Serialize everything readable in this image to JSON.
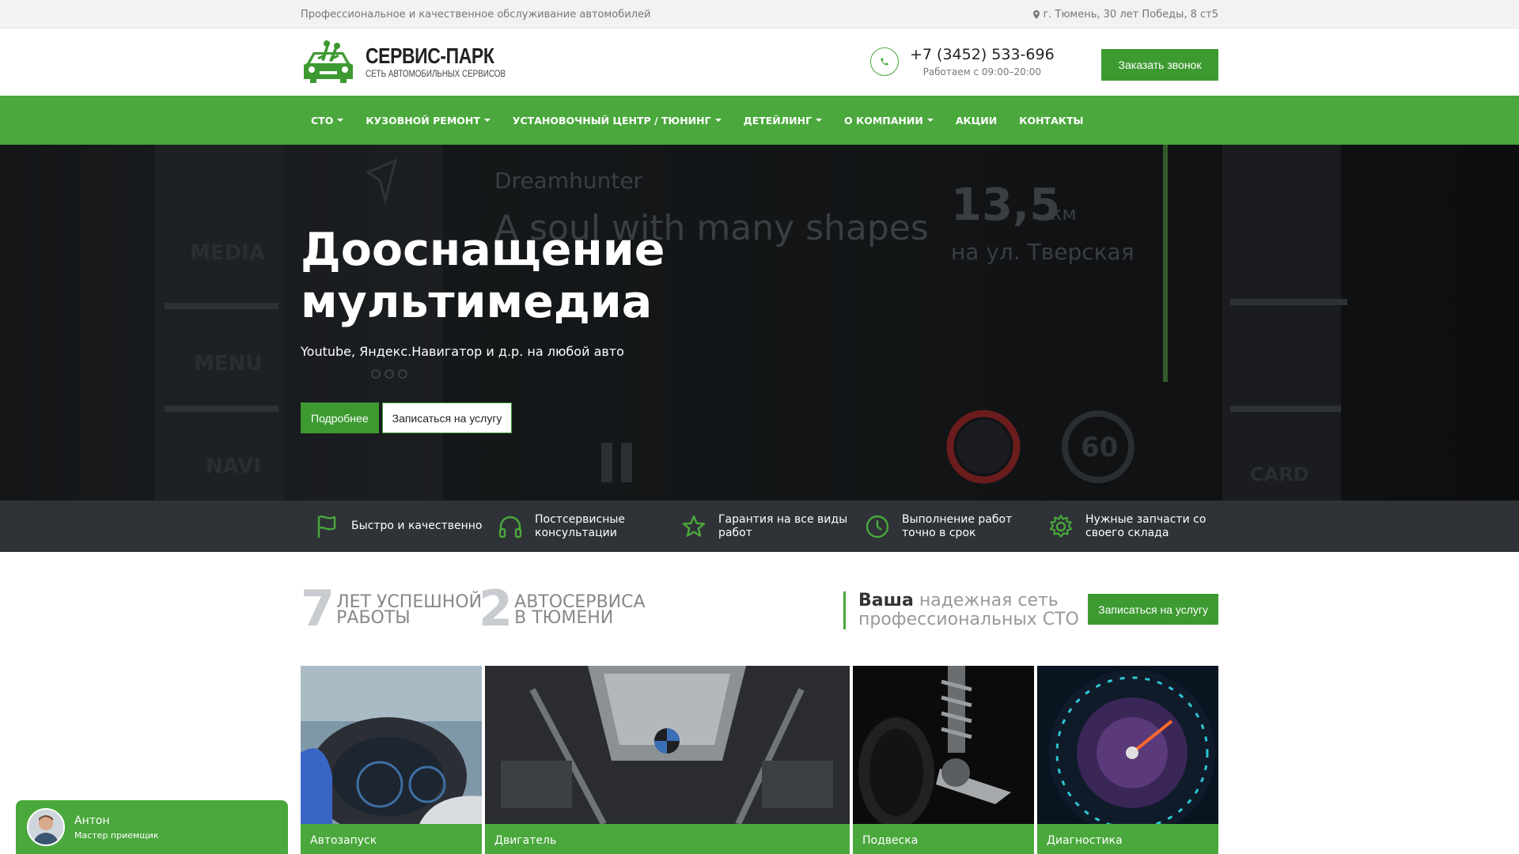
{
  "topbar": {
    "tagline": "Профессиональное и качественное обслуживание автомобилей",
    "address": "г. Тюмень, 30 лет Победы, 8 ст5"
  },
  "header": {
    "logo_title": "СЕРВИС-ПАРК",
    "logo_subtitle": "Сеть автомобильных сервисов",
    "phone": "+7 (3452) 533-696",
    "hours": "Работаем с 09:00–20:00",
    "callback_label": "Заказать звонок"
  },
  "nav": {
    "items": [
      {
        "label": "СТО",
        "dropdown": true
      },
      {
        "label": "КУЗОВНОЙ РЕМОНТ",
        "dropdown": true
      },
      {
        "label": "УСТАНОВОЧНЫЙ ЦЕНТР / ТЮНИНГ",
        "dropdown": true
      },
      {
        "label": "ДЕТЕЙЛИНГ",
        "dropdown": true
      },
      {
        "label": "О КОМПАНИИ",
        "dropdown": true
      },
      {
        "label": "АКЦИИ",
        "dropdown": false
      },
      {
        "label": "КОНТАКТЫ",
        "dropdown": false
      }
    ]
  },
  "hero": {
    "title": "Дооснащение мультимедиа",
    "subtitle": "Youtube, Яндекс.Навигатор и д.р. на любой авто",
    "more_label": "Подробнее",
    "signup_label": "Записаться на услугу",
    "background_texts": {
      "app": "Dreamhunter",
      "track": "A soul with many shapes",
      "distance": "13,5",
      "distance_unit": "км",
      "street": "на ул. Тверская",
      "media": "MEDIA",
      "menu": "MENU",
      "navi": "NAVI",
      "card": "CARD",
      "speed_limit": "60"
    }
  },
  "features": [
    {
      "icon": "flag-icon",
      "text": "Быстро и качественно"
    },
    {
      "icon": "headphones-icon",
      "text": "Постсервисные консультации"
    },
    {
      "icon": "star-icon",
      "text": "Гарантия на все виды работ"
    },
    {
      "icon": "clock-icon",
      "text": "Выполнение работ точно в срок"
    },
    {
      "icon": "gear-icon",
      "text": "Нужные запчасти со своего склада"
    }
  ],
  "stats": {
    "years_num": "7",
    "years_text_1": "ЛЕТ УСПЕШНОЙ",
    "years_text_2": "РАБОТЫ",
    "services_num": "2",
    "services_text_1": "АВТОСЕРВИСА",
    "services_text_2": "В ТЮМЕНИ",
    "slogan_bold": "Ваша",
    "slogan_rest_1": " надежная сеть",
    "slogan_rest_2": "профессиональных СТО",
    "signup_label": "Записаться на услугу"
  },
  "tiles": [
    {
      "label": "Автозапуск"
    },
    {
      "label": "Двигатель"
    },
    {
      "label": "Подвеска"
    },
    {
      "label": "Диагностика"
    }
  ],
  "chat": {
    "name": "Антон",
    "role": "Мастер приемщик"
  },
  "colors": {
    "brand_green": "#4aa83c",
    "button_green": "#3d9a31",
    "features_bg": "#2f3337"
  }
}
